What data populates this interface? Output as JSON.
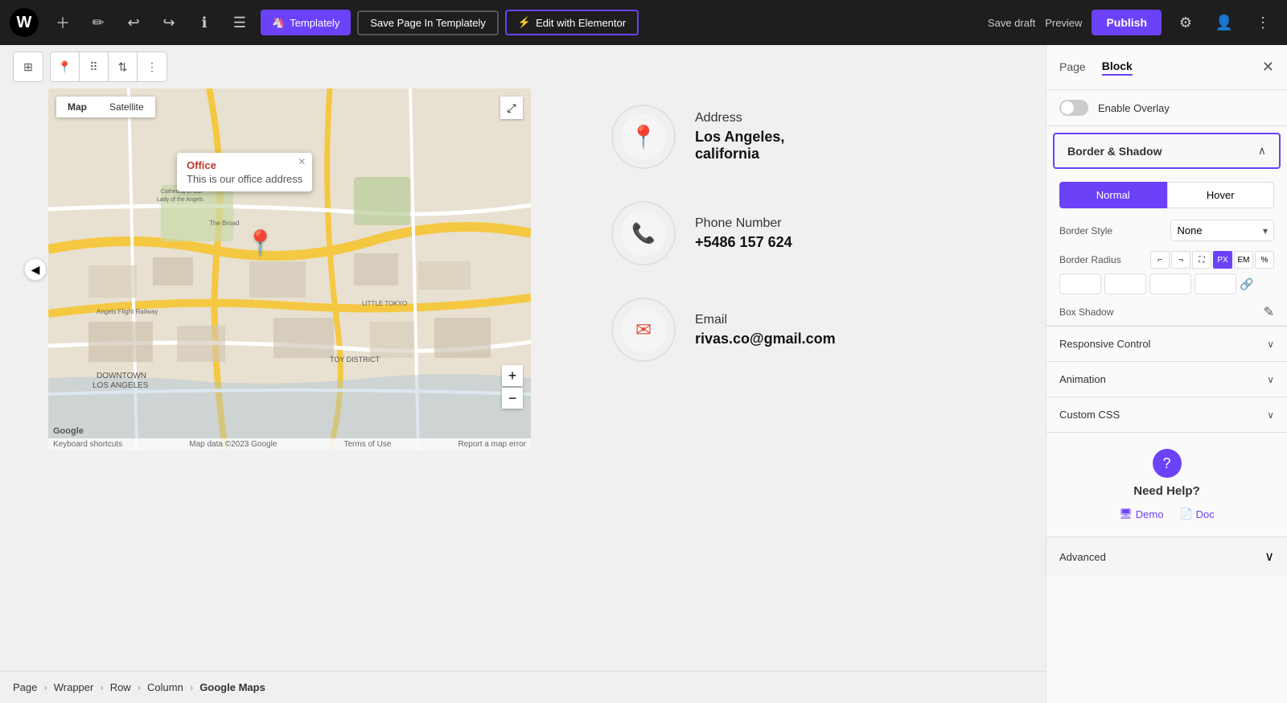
{
  "topbar": {
    "wp_logo": "W",
    "buttons": {
      "templately": "Templately",
      "save_in_templately": "Save Page In Templately",
      "edit_elementor": "Edit with Elementor",
      "save_draft": "Save draft",
      "preview": "Preview",
      "publish": "Publish"
    }
  },
  "toolbar": {
    "groups": [
      "columns-icon",
      "location-icon",
      "grid-icon",
      "arrows-icon",
      "dots-icon"
    ]
  },
  "map": {
    "tab_map": "Map",
    "tab_satellite": "Satellite",
    "popup_title": "Office",
    "popup_text": "This is our office address",
    "zoom_plus": "+",
    "zoom_minus": "−",
    "footer_keyboard": "Keyboard shortcuts",
    "footer_mapdata": "Map data ©2023 Google",
    "footer_terms": "Terms of Use",
    "footer_report": "Report a map error",
    "google_logo": "Google"
  },
  "contact": {
    "items": [
      {
        "label": "Address",
        "value": "Los Angeles,\ncalifornia",
        "icon": "📍"
      },
      {
        "label": "Phone Number",
        "value": "+5486 157 624",
        "icon": "📞"
      },
      {
        "label": "Email",
        "value": "rivas.co@gmail.com",
        "icon": "✉"
      }
    ]
  },
  "breadcrumb": {
    "items": [
      "Page",
      "Wrapper",
      "Row",
      "Column",
      "Google Maps"
    ]
  },
  "panel": {
    "tab_page": "Page",
    "tab_block": "Block",
    "enable_overlay_label": "Enable Overlay",
    "border_shadow_title": "Border & Shadow",
    "state_normal": "Normal",
    "state_hover": "Hover",
    "border_style_label": "Border Style",
    "border_style_value": "None",
    "border_radius_label": "Border Radius",
    "br_units": [
      "PX",
      "EM",
      "%"
    ],
    "br_active_unit": "PX",
    "box_shadow_label": "Box Shadow",
    "sections": [
      {
        "title": "Responsive Control"
      },
      {
        "title": "Animation"
      },
      {
        "title": "Custom CSS"
      }
    ],
    "help_title": "Need Help?",
    "help_demo": "Demo",
    "help_doc": "Doc",
    "advanced_title": "Advanced"
  }
}
